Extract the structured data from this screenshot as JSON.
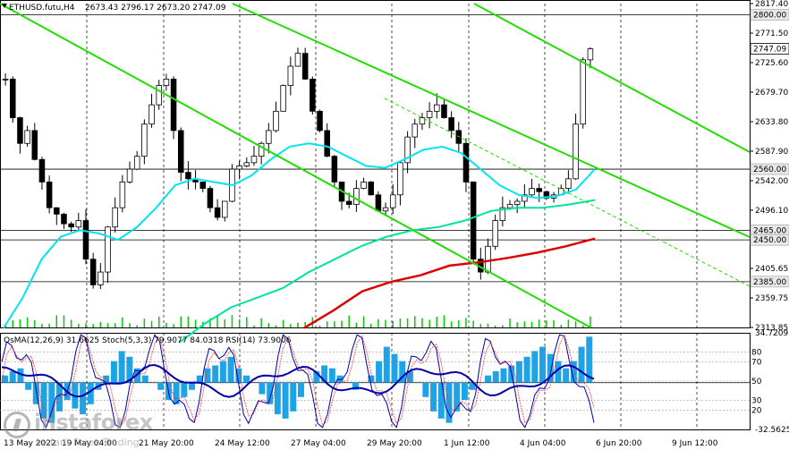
{
  "header": {
    "symbol": "ETHUSD.futu,H4",
    "ohlc": "2673.43 2796.17 2673.20 2747.09",
    "indicators": "OsMA(12,26,9) 31.6625  Stoch(5,3,3) 79.9077 84.0318  RSI(14) 73.9006"
  },
  "watermark": {
    "brand": "instaforex",
    "tagline": "Instant Forex Trading"
  },
  "colors": {
    "background": "#ffffff",
    "candle": "#00cc00",
    "grid": "#000000",
    "ema_fast": "#00e5ee",
    "ema_mid": "#00e3a0",
    "ema_slow": "#dd0000",
    "channel": "#22dd00",
    "osma_bar": "#1ea3e6",
    "stoch_main": "#0000aa",
    "stoch_signal": "#ff3333",
    "rsi": "#aa00cc",
    "price_label_bg": "#e8e8e8"
  },
  "x_axis_labels": [
    "13 May 2022",
    "19 May 04:00",
    "21 May 20:00",
    "24 May 12:00",
    "27 May 04:00",
    "29 May 20:00",
    "1 Jun 12:00",
    "4 Jun 04:00",
    "6 Jun 20:00",
    "9 Jun 12:00"
  ],
  "chart_data": [
    {
      "type": "candlestick",
      "title": "ETHUSD.futu,H4",
      "ylim": [
        2313.85,
        2817.4
      ],
      "y_ticks": [
        "2817.40",
        "2771.50",
        "2725.60",
        "2679.70",
        "2633.80",
        "2587.90",
        "2542.00",
        "2496.10",
        "2405.65",
        "2359.75",
        "2313.85"
      ],
      "horizontal_levels": [
        {
          "value": 2800.0,
          "label": "2800.00"
        },
        {
          "value": 2560.0,
          "label": "2560.00"
        },
        {
          "value": 2465.0,
          "label": "2465.00"
        },
        {
          "value": 2450.0,
          "label": "2450.00"
        },
        {
          "value": 2385.0,
          "label": "2385.00"
        }
      ],
      "current_price": {
        "value": 2747.09,
        "label": "2747.09"
      },
      "ohlc_last": {
        "open": 2673.43,
        "high": 2796.17,
        "low": 2673.2,
        "close": 2747.09
      },
      "close_path": [
        2700,
        2640,
        2600,
        2620,
        2575,
        2540,
        2500,
        2490,
        2475,
        2470,
        2480,
        2420,
        2380,
        2400,
        2470,
        2500,
        2540,
        2560,
        2580,
        2630,
        2660,
        2690,
        2700,
        2620,
        2555,
        2545,
        2540,
        2530,
        2500,
        2485,
        2510,
        2560,
        2565,
        2570,
        2580,
        2600,
        2620,
        2650,
        2690,
        2720,
        2740,
        2700,
        2650,
        2620,
        2580,
        2540,
        2510,
        2505,
        2530,
        2540,
        2520,
        2495,
        2500,
        2520,
        2570,
        2610,
        2630,
        2640,
        2650,
        2660,
        2640,
        2620,
        2600,
        2540,
        2420,
        2400,
        2440,
        2480,
        2500,
        2505,
        2510,
        2520,
        2530,
        2525,
        2515,
        2520,
        2530,
        2545,
        2630,
        2730,
        2747.09
      ],
      "ema_fast": [
        2313,
        2360,
        2420,
        2455,
        2465,
        2460,
        2450,
        2470,
        2500,
        2535,
        2545,
        2540,
        2535,
        2550,
        2575,
        2595,
        2600,
        2595,
        2580,
        2565,
        2562,
        2575,
        2590,
        2595,
        2585,
        2560,
        2535,
        2520,
        2515,
        2518,
        2528,
        2560
      ],
      "ema_mid": [
        2290,
        2320,
        2345,
        2360,
        2375,
        2400,
        2420,
        2440,
        2455,
        2465,
        2470,
        2480,
        2495,
        2500,
        2500,
        2505,
        2512
      ],
      "ema_slow": [
        2313,
        2340,
        2370,
        2385,
        2395,
        2410,
        2415,
        2422,
        2430,
        2440,
        2452
      ],
      "channel_lines": [
        {
          "from": [
            "13 May",
            2817
          ],
          "to": [
            "5 Jun",
            2313
          ]
        },
        {
          "from": [
            "24 May",
            2817
          ],
          "to": [
            "9 Jun",
            2560
          ]
        },
        {
          "from": [
            "3 Jun",
            2817
          ],
          "to": [
            "10 Jun",
            2590
          ]
        },
        {
          "from": [
            "30 May",
            2625
          ],
          "to": [
            "10 Jun",
            2385
          ]
        }
      ]
    },
    {
      "type": "bar",
      "title": "OsMA(12,26,9) 31.6625  Stoch(5,3,3) 79.9077 84.0318  RSI(14) 73.9006",
      "ylim": [
        -32.5625,
        34.7209
      ],
      "y_ticks": [
        "34.7209",
        "-32.5625"
      ],
      "stoch_levels": [
        "80",
        "70",
        "50",
        "30",
        "20"
      ],
      "series": [
        {
          "name": "OsMA(12,26,9)",
          "last": 31.6625,
          "values": [
            5,
            8,
            10,
            -5,
            -15,
            -25,
            -28,
            -20,
            -12,
            -18,
            -22,
            -15,
            -5,
            5,
            15,
            22,
            18,
            10,
            5,
            0,
            -5,
            -12,
            -15,
            -10,
            -5,
            5,
            10,
            12,
            15,
            18,
            10,
            5,
            0,
            -8,
            -15,
            -22,
            -25,
            -20,
            -10,
            0,
            8,
            12,
            10,
            5,
            0,
            -5,
            0,
            5,
            15,
            25,
            20,
            15,
            8,
            0,
            -10,
            -20,
            -25,
            -28,
            -20,
            -12,
            -5,
            0,
            5,
            8,
            10,
            12,
            15,
            18,
            22,
            25,
            20,
            15,
            10,
            15,
            25,
            32
          ]
        },
        {
          "name": "Stoch main",
          "last": 79.9077
        },
        {
          "name": "Stoch signal",
          "last": 84.0318
        },
        {
          "name": "RSI(14)",
          "last": 73.9006
        }
      ]
    }
  ]
}
